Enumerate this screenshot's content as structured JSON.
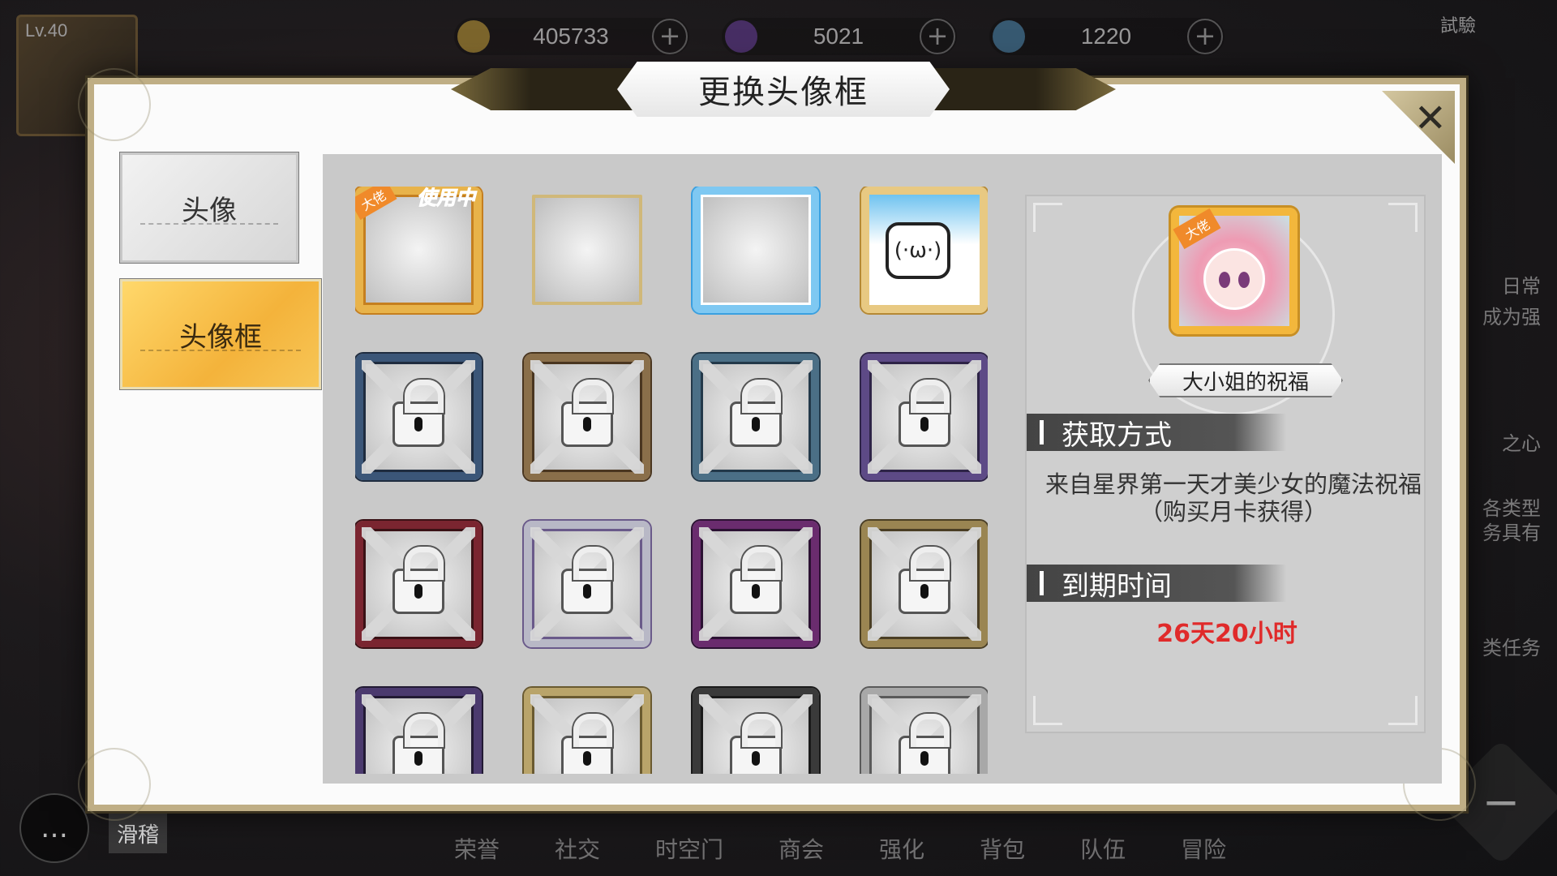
{
  "hud": {
    "player_level": "Lv.40",
    "currencies": [
      {
        "value": "405733",
        "icon": "gold-coin-icon",
        "color": "#c9a33a"
      },
      {
        "value": "5021",
        "icon": "purple-gem-icon",
        "color": "#6b3fa0"
      },
      {
        "value": "1220",
        "icon": "rainbow-orb-icon",
        "color": "#4f8fb8"
      }
    ],
    "plus_label": "+",
    "top_right_label": "試驗",
    "side_texts": [
      "日常",
      "成为强",
      "之心",
      "各类型\n务具有",
      "类任务"
    ],
    "bottom_nav": [
      "荣誉",
      "社交",
      "时空门",
      "商会",
      "强化",
      "背包",
      "队伍",
      "冒险"
    ],
    "chat_tag": "滑稽",
    "chat_icon": "chat-bubble-icon",
    "minus_label": "−"
  },
  "dialog": {
    "title": "更换头像框",
    "close_label": "✕"
  },
  "tabs": [
    {
      "label": "头像",
      "active": false
    },
    {
      "label": "头像框",
      "active": true
    }
  ],
  "frames": {
    "in_use_label": "使用中",
    "rank_ribbon": "大佬",
    "tv_face": "(·ω·)",
    "items": [
      {
        "kind": "equipped",
        "c1": "#e8b34a",
        "c2": "#c57f1f",
        "locked": false
      },
      {
        "kind": "plain",
        "c1": "#d0b879",
        "c2": "#a88f50",
        "locked": false
      },
      {
        "kind": "bili",
        "c1": "#7ec8f2",
        "c2": "#3aa0e0",
        "locked": false
      },
      {
        "kind": "tv",
        "c1": "#e8c982",
        "c2": "#b58935",
        "locked": false
      },
      {
        "kind": "locked",
        "c1": "#3b5678",
        "c2": "#1f2c3f",
        "locked": true
      },
      {
        "kind": "locked",
        "c1": "#8a6f4a",
        "c2": "#4a3620",
        "locked": true
      },
      {
        "kind": "locked",
        "c1": "#4b6f86",
        "c2": "#23394a",
        "locked": true
      },
      {
        "kind": "locked",
        "c1": "#5d4a86",
        "c2": "#2e2447",
        "locked": true
      },
      {
        "kind": "locked",
        "c1": "#7a2530",
        "c2": "#3a1216",
        "locked": true
      },
      {
        "kind": "locked",
        "c1": "#b8b8c6",
        "c2": "#6a5a8a",
        "locked": true
      },
      {
        "kind": "locked",
        "c1": "#6a2c6e",
        "c2": "#2c1233",
        "locked": true
      },
      {
        "kind": "locked",
        "c1": "#9a8552",
        "c2": "#4a3e24",
        "locked": true
      },
      {
        "kind": "locked",
        "c1": "#4b3a6e",
        "c2": "#221a33",
        "locked": true
      },
      {
        "kind": "locked",
        "c1": "#b9a46a",
        "c2": "#6a5a30",
        "locked": true
      },
      {
        "kind": "locked",
        "c1": "#3a3a3a",
        "c2": "#1a1a1a",
        "locked": true
      },
      {
        "kind": "locked",
        "c1": "#a8a8a8",
        "c2": "#5a5a5a",
        "locked": true
      }
    ]
  },
  "detail": {
    "frame_name": "大小姐的祝福",
    "acquire_header": "获取方式",
    "acquire_text": "来自星界第一天才美少女的魔法祝福（购买月卡获得）",
    "expire_header": "到期时间",
    "expire_value": "26天20小时",
    "expire_color": "#e02a2a"
  }
}
